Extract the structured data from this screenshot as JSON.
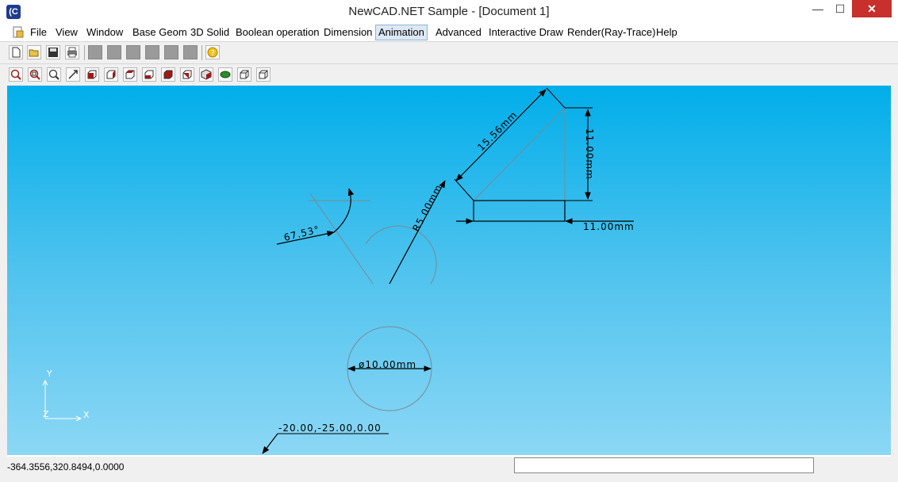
{
  "window": {
    "title": "NewCAD.NET Sample - [Document 1]",
    "app_icon": "cad-logo-icon",
    "controls": {
      "minimize": "—",
      "maximize": "☐",
      "close": "✕"
    }
  },
  "menu": {
    "items": [
      "File",
      "View",
      "Window",
      "Base Geom",
      "3D Solid",
      "Boolean operation",
      "Dimension",
      "Animation",
      "Advanced",
      "Interactive Draw",
      "Render(Ray-Trace)",
      "Help"
    ],
    "active": "Animation",
    "mdi_controls": [
      "_",
      "❐",
      "✕"
    ]
  },
  "toolbar1": {
    "buttons": [
      "new-file-icon",
      "open-folder-icon",
      "save-icon",
      "print-icon",
      "disabled-icon",
      "disabled-icon",
      "disabled-icon",
      "disabled-icon",
      "disabled-icon",
      "disabled-icon",
      "help-icon"
    ]
  },
  "toolbar2": {
    "buttons": [
      "zoom-all-icon",
      "zoom-window-icon",
      "zoom-in-icon",
      "pan-icon",
      "view-front-icon",
      "view-back-icon",
      "view-left-icon",
      "view-right-icon",
      "view-top-icon",
      "view-bottom-icon",
      "view-iso-icon",
      "render-icon",
      "wireframe-icon",
      "hidden-line-icon"
    ]
  },
  "canvas": {
    "background_top": "#01aeea",
    "background_bottom": "#8cd7f5",
    "dimensions": {
      "angular": "67.53°",
      "radius": "R5.00mm",
      "aligned": "15.56mm",
      "vertical": "11.00mm",
      "horizontal": "11.00mm",
      "diameter": "ø10.00mm",
      "leader": "-20.00,-25.00,0.00"
    },
    "axes": {
      "x": "X",
      "y": "Y",
      "z": "Z"
    }
  },
  "status": {
    "coordinates": "-364.3556,320.8494,0.0000",
    "message": ""
  }
}
